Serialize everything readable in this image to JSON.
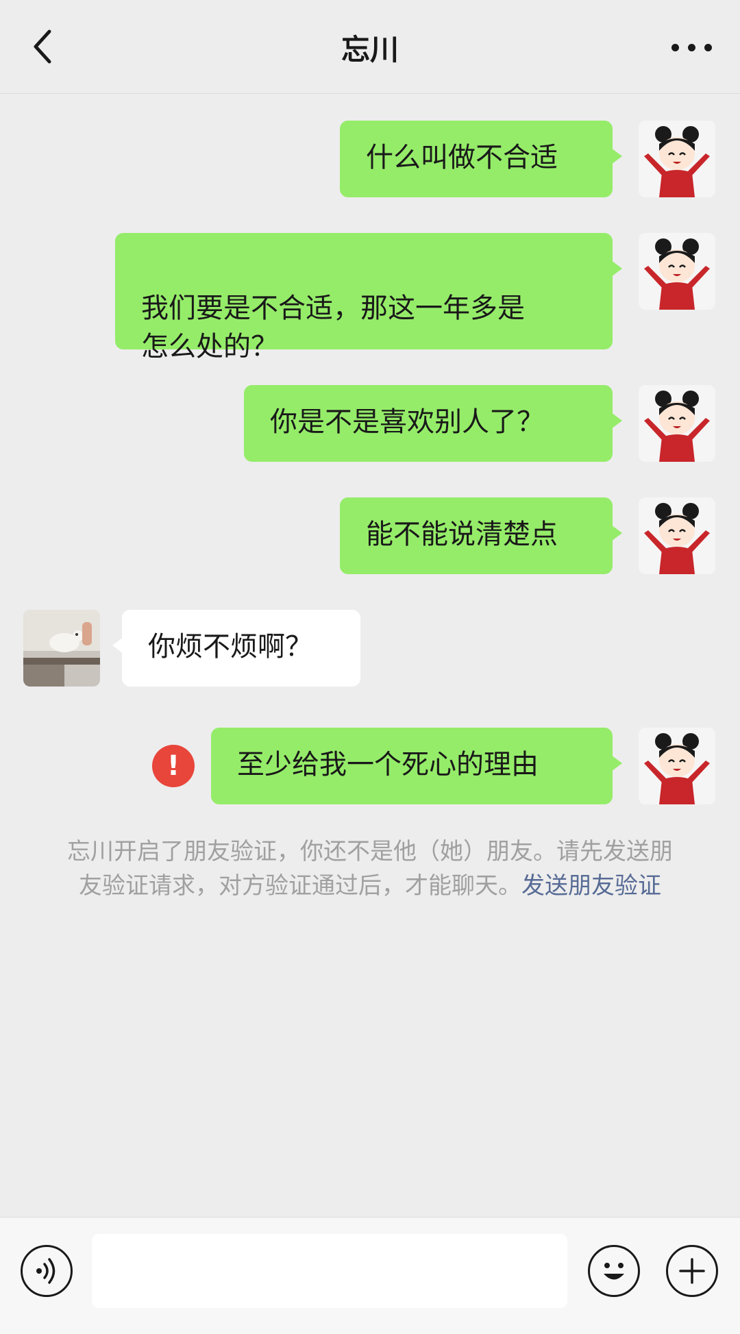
{
  "header": {
    "title": "忘川",
    "back_icon": "chevron-left-icon",
    "more_icon": "more-dots-icon"
  },
  "messages": [
    {
      "side": "mine",
      "text": "什么叫做不合适"
    },
    {
      "side": "mine",
      "text": "我们要是不合适，那这一年多是\n怎么处的？"
    },
    {
      "side": "mine",
      "text": "你是不是喜欢别人了？"
    },
    {
      "side": "mine",
      "text": "能不能说清楚点"
    },
    {
      "side": "theirs",
      "text": "你烦不烦啊？"
    },
    {
      "side": "mine",
      "text": "至少给我一个死心的理由",
      "failed": true
    }
  ],
  "error_mark": "!",
  "system_notice": {
    "text": "忘川开启了朋友验证，你还不是他（她）朋友。请先发送朋友验证请求，对方验证通过后，才能聊天。",
    "link": "发送朋友验证"
  },
  "input_bar": {
    "value": "",
    "placeholder": "",
    "voice_icon": "voice-icon",
    "emoji_icon": "emoji-icon",
    "plus_icon": "plus-icon"
  },
  "colors": {
    "background": "#ededed",
    "bubble_mine": "#95ec69",
    "bubble_theirs": "#ffffff",
    "error": "#e8453b",
    "link": "#576b95"
  }
}
